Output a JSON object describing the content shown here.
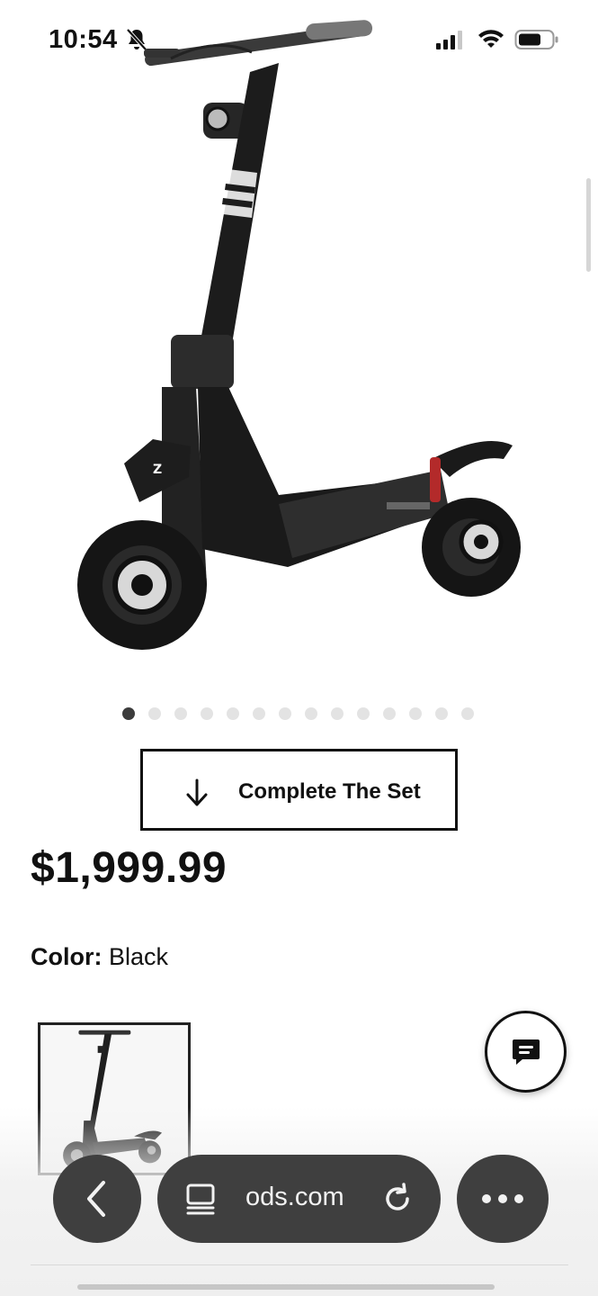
{
  "status_bar": {
    "time": "10:54",
    "icons": [
      "bell-muted-icon",
      "signal-icon",
      "wifi-icon",
      "battery-icon"
    ]
  },
  "product": {
    "image_icon": "electric-scooter-image",
    "carousel": {
      "total": 14,
      "active_index": 0
    },
    "complete_set_label": "Complete The Set",
    "price": "$1,999.99",
    "color_label": "Color:",
    "color_value": "Black",
    "swatches": [
      {
        "icon": "scooter-thumbnail",
        "selected": true
      }
    ]
  },
  "chat": {
    "icon": "chat-bubble-icon"
  },
  "browser": {
    "url": "ods.com",
    "icons": [
      "back-chevron-icon",
      "tabs-icon",
      "reload-icon",
      "more-icon"
    ]
  },
  "colors": {
    "text": "#111111",
    "toolbar_bg": "#3f3f3f",
    "dot_inactive": "#e3e3e3",
    "dot_active": "#3c3c3c"
  }
}
